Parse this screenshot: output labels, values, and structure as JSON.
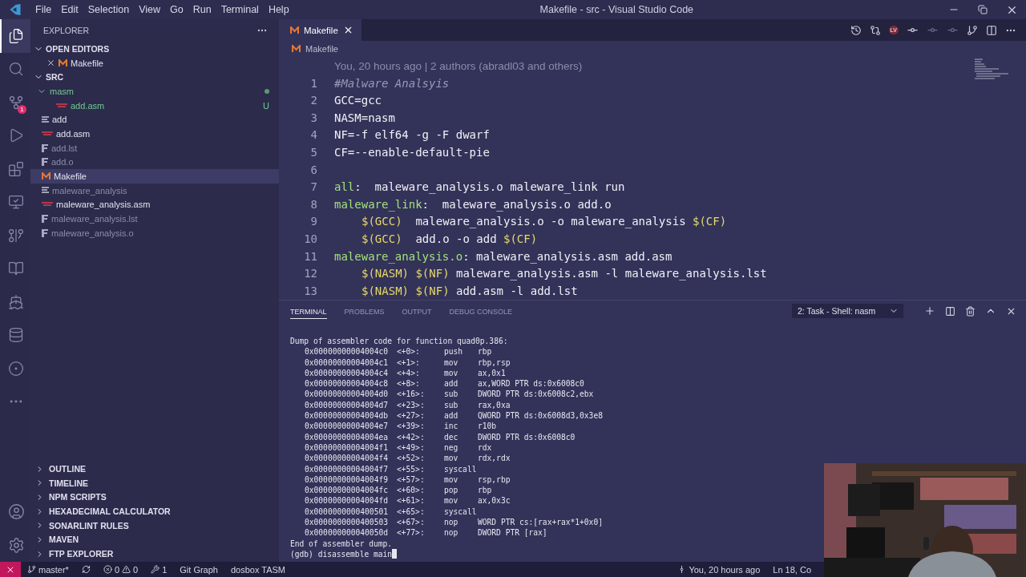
{
  "window": {
    "title": "Makefile - src - Visual Studio Code"
  },
  "menu": [
    "File",
    "Edit",
    "Selection",
    "View",
    "Go",
    "Run",
    "Terminal",
    "Help"
  ],
  "activity_bar": {
    "items": [
      {
        "kind": "files",
        "selected": true
      },
      {
        "kind": "search",
        "selected": false
      },
      {
        "kind": "source-control",
        "selected": false,
        "badge": "1"
      },
      {
        "kind": "run",
        "selected": false
      },
      {
        "kind": "extensions",
        "selected": false
      },
      {
        "kind": "remote",
        "selected": false
      },
      {
        "kind": "git-graph",
        "selected": false
      },
      {
        "kind": "book",
        "selected": false
      },
      {
        "kind": "docker",
        "selected": false
      },
      {
        "kind": "database",
        "selected": false
      },
      {
        "kind": "live-share",
        "selected": false
      },
      {
        "kind": "more",
        "selected": false
      }
    ],
    "bottom": [
      {
        "kind": "account"
      },
      {
        "kind": "settings"
      }
    ]
  },
  "sidebar": {
    "title": "EXPLORER",
    "open_editors": {
      "label": "OPEN EDITORS",
      "expanded": true,
      "items": [
        {
          "name": "Makefile",
          "kind": "makefile"
        }
      ]
    },
    "folder": {
      "label": "SRC",
      "expanded": true,
      "items": [
        {
          "name": "masm",
          "kind": "folder",
          "expanded": true,
          "changed": true,
          "selected": false,
          "children": [
            {
              "name": "add.asm",
              "kind": "asm",
              "changed": true,
              "status": "U",
              "selected": false
            }
          ]
        },
        {
          "name": "add",
          "kind": "text",
          "selected": false,
          "dimmed": false
        },
        {
          "name": "add.asm",
          "kind": "asm",
          "selected": false,
          "dimmed": false
        },
        {
          "name": "add.lst",
          "kind": "binary",
          "selected": false,
          "dimmed": true
        },
        {
          "name": "add.o",
          "kind": "binary",
          "selected": false,
          "dimmed": true
        },
        {
          "name": "Makefile",
          "kind": "makefile",
          "selected": true,
          "dimmed": false
        },
        {
          "name": "maleware_analysis",
          "kind": "text",
          "selected": false,
          "dimmed": true
        },
        {
          "name": "maleware_analysis.asm",
          "kind": "asm",
          "selected": false,
          "dimmed": false
        },
        {
          "name": "maleware_analysis.lst",
          "kind": "binary",
          "selected": false,
          "dimmed": true
        },
        {
          "name": "maleware_analysis.o",
          "kind": "binary",
          "selected": false,
          "dimmed": true
        }
      ]
    },
    "sections": [
      {
        "label": "OUTLINE",
        "expanded": false
      },
      {
        "label": "TIMELINE",
        "expanded": false
      },
      {
        "label": "NPM SCRIPTS",
        "expanded": false
      },
      {
        "label": "HEXADECIMAL CALCULATOR",
        "expanded": false
      },
      {
        "label": "SONARLINT RULES",
        "expanded": false
      },
      {
        "label": "MAVEN",
        "expanded": false
      },
      {
        "label": "FTP EXPLORER",
        "expanded": false
      }
    ]
  },
  "editor": {
    "tabs": [
      {
        "label": "Makefile",
        "kind": "makefile",
        "selected": true
      }
    ],
    "toolbar": [
      {
        "kind": "history"
      },
      {
        "kind": "compare"
      },
      {
        "kind": "badge",
        "text": "LV"
      },
      {
        "kind": "commit",
        "disabled": false
      },
      {
        "kind": "commit",
        "disabled": true
      },
      {
        "kind": "commit",
        "disabled": true
      },
      {
        "kind": "git-flow"
      },
      {
        "kind": "split"
      },
      {
        "kind": "more"
      }
    ],
    "breadcrumb": "Makefile",
    "blame": "You, 20 hours ago | 2 authors (abradl03 and others)",
    "lines": [
      {
        "number": "1",
        "tokens": [
          {
            "text": "#Malware Analsyis",
            "kind": "comment"
          }
        ]
      },
      {
        "number": "2",
        "tokens": [
          {
            "text": "GCC=gcc",
            "kind": "text"
          }
        ]
      },
      {
        "number": "3",
        "tokens": [
          {
            "text": "NASM=nasm",
            "kind": "text"
          }
        ]
      },
      {
        "number": "4",
        "tokens": [
          {
            "text": "NF=-f elf64 -g -F dwarf",
            "kind": "text"
          }
        ]
      },
      {
        "number": "5",
        "tokens": [
          {
            "text": "CF=--enable-default-pie",
            "kind": "text"
          }
        ]
      },
      {
        "number": "6"
      },
      {
        "number": "7",
        "tokens": [
          {
            "text": "all",
            "kind": "target"
          },
          {
            "text": ":  maleware_analysis.o maleware_link run",
            "kind": "text"
          }
        ]
      },
      {
        "number": "8",
        "tokens": [
          {
            "text": "maleware_link",
            "kind": "target"
          },
          {
            "text": ":  maleware_analysis.o add.o",
            "kind": "text"
          }
        ]
      },
      {
        "number": "9",
        "indent": true,
        "tokens": [
          {
            "text": "$(GCC)",
            "kind": "var"
          },
          {
            "text": "  maleware_analysis.o -o maleware_analysis ",
            "kind": "text"
          },
          {
            "text": "$(CF)",
            "kind": "var"
          }
        ]
      },
      {
        "number": "10",
        "indent": true,
        "tokens": [
          {
            "text": "$(GCC)",
            "kind": "var"
          },
          {
            "text": "  add.o -o add ",
            "kind": "text"
          },
          {
            "text": "$(CF)",
            "kind": "var"
          }
        ]
      },
      {
        "number": "11",
        "tokens": [
          {
            "text": "maleware_analysis.o",
            "kind": "target"
          },
          {
            "text": ": maleware_analysis.asm add.asm",
            "kind": "text"
          }
        ]
      },
      {
        "number": "12",
        "indent": true,
        "tokens": [
          {
            "text": "$(NASM) $(NF)",
            "kind": "var"
          },
          {
            "text": " maleware_analysis.asm -l maleware_analysis.lst",
            "kind": "text"
          }
        ]
      },
      {
        "number": "13",
        "indent": true,
        "tokens": [
          {
            "text": "$(NASM) $(NF)",
            "kind": "var"
          },
          {
            "text": " add.asm -l add.lst",
            "kind": "text"
          }
        ]
      }
    ]
  },
  "panel": {
    "tabs": [
      {
        "label": "TERMINAL",
        "selected": true
      },
      {
        "label": "PROBLEMS",
        "selected": false
      },
      {
        "label": "OUTPUT",
        "selected": false
      },
      {
        "label": "DEBUG CONSOLE",
        "selected": false
      }
    ],
    "terminal_select": "2: Task - Shell: nasm",
    "actions": [
      {
        "kind": "new"
      },
      {
        "kind": "split"
      },
      {
        "kind": "delete"
      },
      {
        "kind": "maximize"
      },
      {
        "kind": "close"
      }
    ],
    "header": "Dump of assembler code for function quad0p.386:",
    "instructions": [
      {
        "address": "0x00000000004004c0",
        "offset": "<+0>:",
        "mnemonic": "push",
        "operands": "rbp"
      },
      {
        "address": "0x00000000004004c1",
        "offset": "<+1>:",
        "mnemonic": "mov",
        "operands": "rbp,rsp"
      },
      {
        "address": "0x00000000004004c4",
        "offset": "<+4>:",
        "mnemonic": "mov",
        "operands": "ax,0x1"
      },
      {
        "address": "0x00000000004004c8",
        "offset": "<+8>:",
        "mnemonic": "add",
        "operands": "ax,WORD PTR ds:0x6008c0"
      },
      {
        "address": "0x00000000004004d0",
        "offset": "<+16>:",
        "mnemonic": "sub",
        "operands": "DWORD PTR ds:0x6008c2,ebx"
      },
      {
        "address": "0x00000000004004d7",
        "offset": "<+23>:",
        "mnemonic": "sub",
        "operands": "rax,0xa"
      },
      {
        "address": "0x00000000004004db",
        "offset": "<+27>:",
        "mnemonic": "add",
        "operands": "QWORD PTR ds:0x6008d3,0x3e8"
      },
      {
        "address": "0x00000000004004e7",
        "offset": "<+39>:",
        "mnemonic": "inc",
        "operands": "r10b"
      },
      {
        "address": "0x00000000004004ea",
        "offset": "<+42>:",
        "mnemonic": "dec",
        "operands": "DWORD PTR ds:0x6008c0"
      },
      {
        "address": "0x00000000004004f1",
        "offset": "<+49>:",
        "mnemonic": "neg",
        "operands": "rdx"
      },
      {
        "address": "0x00000000004004f4",
        "offset": "<+52>:",
        "mnemonic": "mov",
        "operands": "rdx,rdx"
      },
      {
        "address": "0x00000000004004f7",
        "offset": "<+55>:",
        "mnemonic": "syscall"
      },
      {
        "address": "0x00000000004004f9",
        "offset": "<+57>:",
        "mnemonic": "mov",
        "operands": "rsp,rbp"
      },
      {
        "address": "0x00000000004004fc",
        "offset": "<+60>:",
        "mnemonic": "pop",
        "operands": "rbp"
      },
      {
        "address": "0x00000000004004fd",
        "offset": "<+61>:",
        "mnemonic": "mov",
        "operands": "ax,0x3c"
      },
      {
        "address": "0x0000000000400501",
        "offset": "<+65>:",
        "mnemonic": "syscall"
      },
      {
        "address": "0x0000000000400503",
        "offset": "<+67>:",
        "mnemonic": "nop",
        "operands": "WORD PTR cs:[rax+rax*1+0x0]"
      },
      {
        "address": "0x000000000040050d",
        "offset": "<+77>:",
        "mnemonic": "nop",
        "operands": "DWORD PTR [rax]"
      }
    ],
    "footer": "End of assembler dump.",
    "prompt": "(gdb) disassemble main"
  },
  "status_bar": {
    "left": [
      {
        "kind": "branch",
        "text": "master*"
      },
      {
        "kind": "sync"
      },
      {
        "kind": "problems",
        "errors": "0",
        "warnings": "0"
      },
      {
        "kind": "tools",
        "text": "1"
      },
      {
        "kind": "text",
        "text": "Git Graph"
      },
      {
        "kind": "text",
        "text": "dosbox TASM"
      }
    ],
    "right": [
      {
        "kind": "blame",
        "text": "You, 20 hours ago"
      },
      {
        "kind": "text",
        "text": "Ln 18, Co"
      }
    ]
  },
  "webcam": {
    "kind": "picture"
  }
}
